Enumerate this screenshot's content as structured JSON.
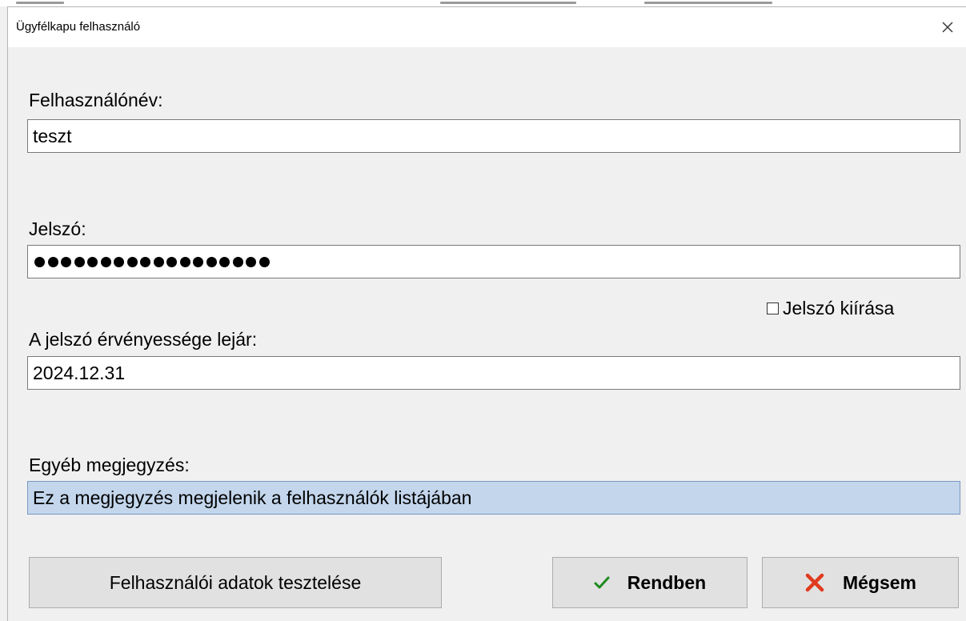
{
  "window": {
    "title": "Ügyfélkapu felhasználó",
    "close_icon": "close-icon"
  },
  "form": {
    "username": {
      "label": "Felhasználónév:",
      "value": "teszt"
    },
    "password": {
      "label": "Jelszó:",
      "masked_length": 18,
      "show_password_label": "Jelszó kiírása",
      "show_password_checked": false
    },
    "expiry": {
      "label": "A jelszó érvényessége lejár:",
      "value": "2024.12.31"
    },
    "note": {
      "label": "Egyéb megjegyzés:",
      "value": "Ez a megjegyzés megjelenik a felhasználók listájában",
      "selected": true
    }
  },
  "buttons": {
    "test_label": "Felhasználói adatok tesztelése",
    "ok_label": "Rendben",
    "ok_icon": "checkmark-icon",
    "cancel_label": "Mégsem",
    "cancel_icon": "cross-icon"
  },
  "colors": {
    "check_green": "#1e8a1e",
    "cross_red": "#e03a1e",
    "selection_blue": "#c3d6ec"
  }
}
